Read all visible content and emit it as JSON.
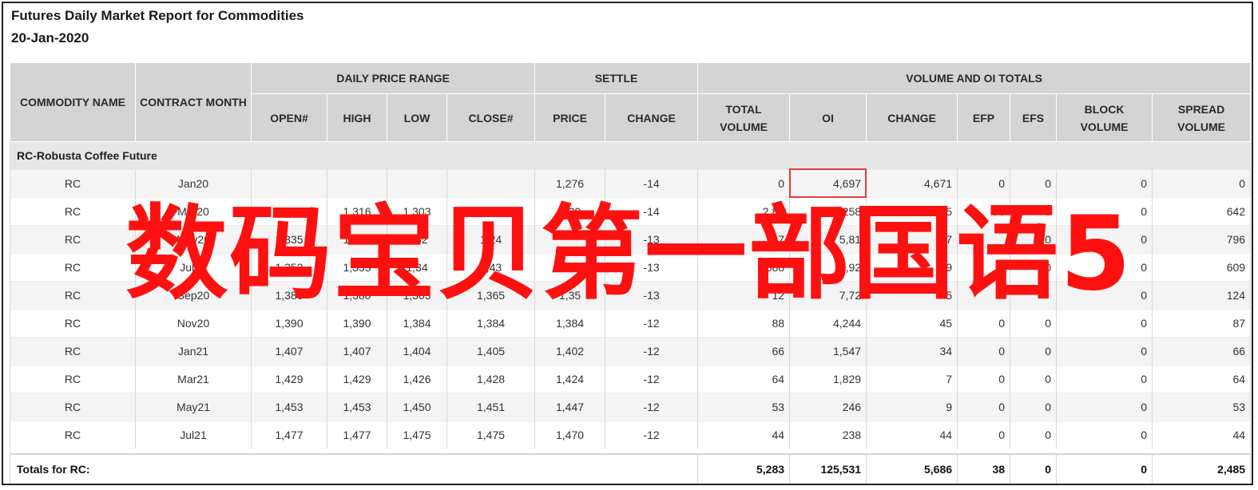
{
  "report": {
    "title": "Futures Daily Market Report for Commodities",
    "date": "20-Jan-2020"
  },
  "headers": {
    "commodity_name": "COMMODITY NAME",
    "contract_month": "CONTRACT MONTH",
    "daily_price_range": "DAILY PRICE RANGE",
    "settle": "SETTLE",
    "volume_oi_totals": "VOLUME AND OI TOTALS",
    "open": "OPEN#",
    "high": "HIGH",
    "low": "LOW",
    "close": "CLOSE#",
    "price": "PRICE",
    "change": "CHANGE",
    "total_volume": "TOTAL VOLUME",
    "oi": "OI",
    "oi_change": "CHANGE",
    "efp": "EFP",
    "efs": "EFS",
    "block_volume": "BLOCK VOLUME",
    "spread_volume": "SPREAD VOLUME"
  },
  "section": "RC-Robusta Coffee Future",
  "rows": [
    {
      "name": "RC",
      "month": "Jan20",
      "open": "",
      "high": "",
      "low": "",
      "close": "",
      "price": "1,276",
      "change": "-14",
      "total_volume": "0",
      "oi": "4,697",
      "oi_change": "4,671",
      "efp": "0",
      "efs": "0",
      "block_volume": "0",
      "spread_volume": "0"
    },
    {
      "name": "RC",
      "month": "Mar20",
      "open": "1,316",
      "high": "1,316",
      "low": "1,303",
      "close": "1,304",
      "price": "1,30",
      "change": "-14",
      "total_volume": "2,84",
      "oi": "52,258",
      "oi_change": "495",
      "efp": "38",
      "efs": "0",
      "block_volume": "0",
      "spread_volume": "642"
    },
    {
      "name": "RC",
      "month": "May20",
      "open": "1,335",
      "high": "1,335",
      "low": "1,32",
      "close": "1,24",
      "price": "",
      "change": "-13",
      "total_volume": "47",
      "oi": "5,81",
      "oi_change": "7",
      "efp": "",
      "efs": "0",
      "block_volume": "0",
      "spread_volume": "796"
    },
    {
      "name": "RC",
      "month": "Jul20",
      "open": "1,352",
      "high": "1,353",
      "low": "1,34",
      "close": "1,43",
      "price": "",
      "change": "-13",
      "total_volume": "688",
      "oi": "1,92",
      "oi_change": "9",
      "efp": "0",
      "efs": "0",
      "block_volume": "0",
      "spread_volume": "609"
    },
    {
      "name": "RC",
      "month": "Sep20",
      "open": "1,380",
      "high": "1,380",
      "low": "1,365",
      "close": "1,365",
      "price": "1,35",
      "change": "-13",
      "total_volume": "12",
      "oi": "7,72",
      "oi_change": "5",
      "efp": "",
      "efs": "",
      "block_volume": "0",
      "spread_volume": "124"
    },
    {
      "name": "RC",
      "month": "Nov20",
      "open": "1,390",
      "high": "1,390",
      "low": "1,384",
      "close": "1,384",
      "price": "1,384",
      "change": "-12",
      "total_volume": "88",
      "oi": "4,244",
      "oi_change": "45",
      "efp": "0",
      "efs": "0",
      "block_volume": "0",
      "spread_volume": "87"
    },
    {
      "name": "RC",
      "month": "Jan21",
      "open": "1,407",
      "high": "1,407",
      "low": "1,404",
      "close": "1,405",
      "price": "1,402",
      "change": "-12",
      "total_volume": "66",
      "oi": "1,547",
      "oi_change": "34",
      "efp": "0",
      "efs": "0",
      "block_volume": "0",
      "spread_volume": "66"
    },
    {
      "name": "RC",
      "month": "Mar21",
      "open": "1,429",
      "high": "1,429",
      "low": "1,426",
      "close": "1,428",
      "price": "1,424",
      "change": "-12",
      "total_volume": "64",
      "oi": "1,829",
      "oi_change": "7",
      "efp": "0",
      "efs": "0",
      "block_volume": "0",
      "spread_volume": "64"
    },
    {
      "name": "RC",
      "month": "May21",
      "open": "1,453",
      "high": "1,453",
      "low": "1,450",
      "close": "1,451",
      "price": "1,447",
      "change": "-12",
      "total_volume": "53",
      "oi": "246",
      "oi_change": "9",
      "efp": "0",
      "efs": "0",
      "block_volume": "0",
      "spread_volume": "53"
    },
    {
      "name": "RC",
      "month": "Jul21",
      "open": "1,477",
      "high": "1,477",
      "low": "1,475",
      "close": "1,475",
      "price": "1,470",
      "change": "-12",
      "total_volume": "44",
      "oi": "238",
      "oi_change": "44",
      "efp": "0",
      "efs": "0",
      "block_volume": "0",
      "spread_volume": "44"
    }
  ],
  "totals": {
    "label": "Totals for RC:",
    "total_volume": "5,283",
    "oi": "125,531",
    "oi_change": "5,686",
    "efp": "38",
    "efs": "0",
    "block_volume": "0",
    "spread_volume": "2,485"
  },
  "overlay_text": "数码宝贝第一部国语5",
  "colors": {
    "overlay": "#ff1010",
    "highlight_box": "#e53b3b",
    "header_bg": "#d4d4d4"
  }
}
